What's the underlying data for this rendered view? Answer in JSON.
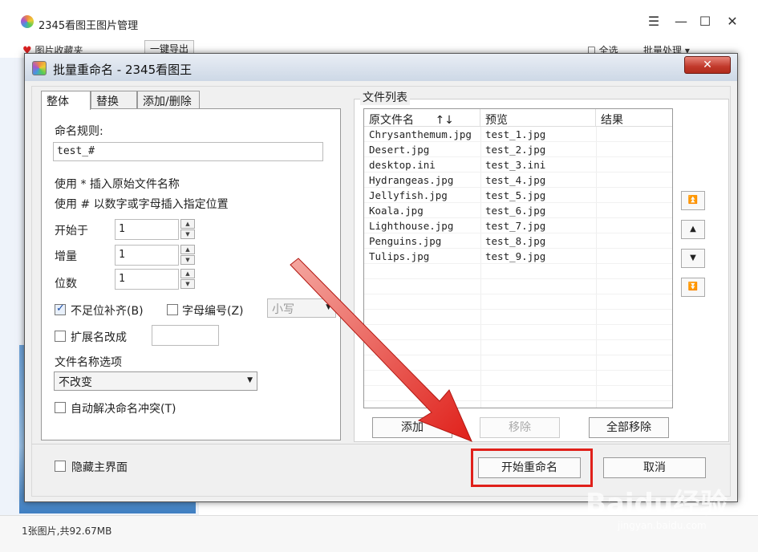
{
  "app": {
    "title": "2345看图王图片管理",
    "toolbar": {
      "favorites": "图片收藏夹",
      "export": "一键导出",
      "select_all": "全选",
      "batch": "批量处理 ▾"
    },
    "status": "1张图片,共92.67MB"
  },
  "watermark": {
    "main": "Baidu经验",
    "sub": "jingyan.baidu.com"
  },
  "dialog": {
    "title": "批量重命名 - 2345看图王",
    "close": "✕",
    "tabs": [
      "整体",
      "替换",
      "添加/删除"
    ],
    "rule_label": "命名规则:",
    "rule_value": "test_#",
    "hint1": "使用 * 插入原始文件名称",
    "hint2": "使用 # 以数字或字母插入指定位置",
    "start_label": "开始于",
    "start_value": "1",
    "step_label": "增量",
    "step_value": "1",
    "digits_label": "位数",
    "digits_value": "1",
    "pad_label": "不足位补齐(B)",
    "alpha_label": "字母编号(Z)",
    "case_select": "小写",
    "ext_label": "扩展名改成",
    "name_opt_label": "文件名称选项",
    "name_opt_value": "不改变",
    "resolve_label": "自动解决命名冲突(T)",
    "file_list_title": "文件列表",
    "columns": {
      "orig": "原文件名",
      "preview": "预览",
      "result": "结果"
    },
    "files": [
      {
        "orig": "Chrysanthemum.jpg",
        "preview": "test_1.jpg"
      },
      {
        "orig": "Desert.jpg",
        "preview": "test_2.jpg"
      },
      {
        "orig": "desktop.ini",
        "preview": "test_3.ini"
      },
      {
        "orig": "Hydrangeas.jpg",
        "preview": "test_4.jpg"
      },
      {
        "orig": "Jellyfish.jpg",
        "preview": "test_5.jpg"
      },
      {
        "orig": "Koala.jpg",
        "preview": "test_6.jpg"
      },
      {
        "orig": "Lighthouse.jpg",
        "preview": "test_7.jpg"
      },
      {
        "orig": "Penguins.jpg",
        "preview": "test_8.jpg"
      },
      {
        "orig": "Tulips.jpg",
        "preview": "test_9.jpg"
      }
    ],
    "add_btn": "添加",
    "remove_btn": "移除",
    "remove_all_btn": "全部移除",
    "hide_main_label": "隐藏主界面",
    "start_btn": "开始重命名",
    "cancel_btn": "取消"
  },
  "colors": {
    "annotation": "#e0201a",
    "close_btn": "#c1392b"
  }
}
